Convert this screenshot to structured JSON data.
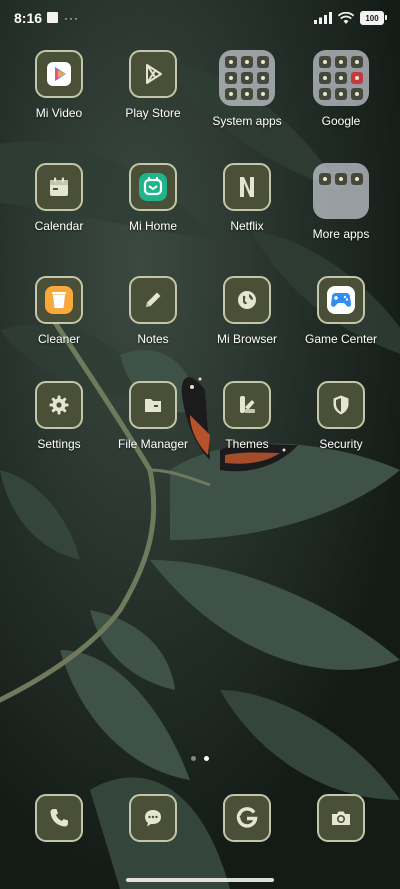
{
  "status_bar": {
    "time": "8:16",
    "battery_level": "100"
  },
  "apps": [
    {
      "label": "Mi Video",
      "icon": "play-triangle-icon"
    },
    {
      "label": "Play Store",
      "icon": "play-store-icon"
    },
    {
      "label": "System apps",
      "icon": "folder-icon"
    },
    {
      "label": "Google",
      "icon": "folder-icon"
    },
    {
      "label": "Calendar",
      "icon": "calendar-icon"
    },
    {
      "label": "Mi Home",
      "icon": "mi-home-icon"
    },
    {
      "label": "Netflix",
      "icon": "netflix-icon"
    },
    {
      "label": "More apps",
      "icon": "folder-icon"
    },
    {
      "label": "Cleaner",
      "icon": "trash-icon"
    },
    {
      "label": "Notes",
      "icon": "pencil-icon"
    },
    {
      "label": "Mi Browser",
      "icon": "globe-icon"
    },
    {
      "label": "Game Center",
      "icon": "gamepad-icon"
    },
    {
      "label": "Settings",
      "icon": "gear-icon"
    },
    {
      "label": "File Manager",
      "icon": "folder-icon"
    },
    {
      "label": "Themes",
      "icon": "themes-icon"
    },
    {
      "label": "Security",
      "icon": "shield-icon"
    }
  ],
  "dock": [
    {
      "icon": "phone-icon"
    },
    {
      "icon": "message-icon"
    },
    {
      "icon": "google-icon"
    },
    {
      "icon": "camera-icon"
    }
  ],
  "page_indicator": {
    "count": 2,
    "active": 2
  },
  "colors": {
    "icon_tile": "#4a4f38",
    "icon_border": "#c3c6a9",
    "folder_bg": "#c8ccd2"
  }
}
